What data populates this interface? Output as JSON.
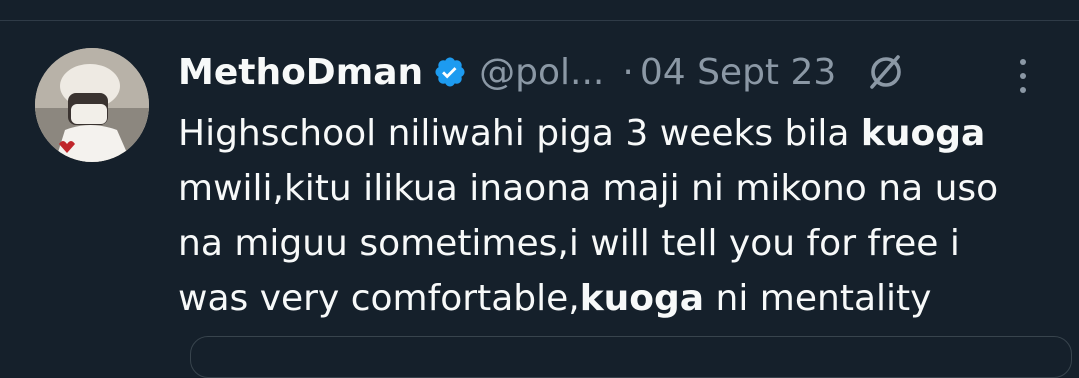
{
  "tweet": {
    "display_name": "MethoDman",
    "handle": "@pol...",
    "separator": "·",
    "date": "04 Sept 23",
    "body_lines": [
      {
        "before": "Highschool niliwahi piga 3 weeks bila ",
        "bold": "kuoga",
        "after": ""
      },
      {
        "before": "mwili,kitu ilikua inaona maji ni mikono na uso",
        "bold": "",
        "after": ""
      },
      {
        "before": "na miguu sometimes,i will tell you for free i",
        "bold": "",
        "after": ""
      },
      {
        "before": "was very comfortable,",
        "bold": "kuoga",
        "after": " ni mentality"
      }
    ]
  },
  "colors": {
    "background": "#15202b",
    "verified": "#1d9bf0",
    "secondary_text": "#8b98a5"
  },
  "icons": [
    "verified-badge-icon",
    "grok-icon",
    "more-options-icon"
  ]
}
